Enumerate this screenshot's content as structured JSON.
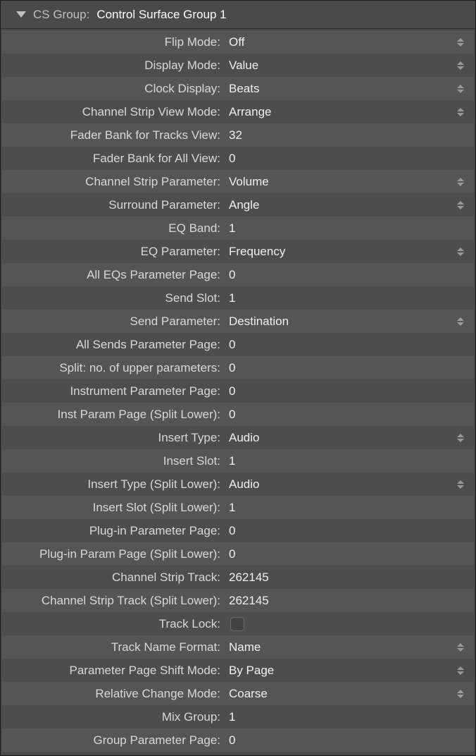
{
  "header": {
    "label": "CS Group:",
    "value": "Control Surface Group 1"
  },
  "rows": [
    {
      "label": "Flip Mode:",
      "value": "Off",
      "type": "select"
    },
    {
      "label": "Display Mode:",
      "value": "Value",
      "type": "select"
    },
    {
      "label": "Clock Display:",
      "value": "Beats",
      "type": "select"
    },
    {
      "label": "Channel Strip View Mode:",
      "value": "Arrange",
      "type": "select"
    },
    {
      "label": "Fader Bank for Tracks View:",
      "value": "32",
      "type": "number"
    },
    {
      "label": "Fader Bank for All View:",
      "value": "0",
      "type": "number"
    },
    {
      "label": "Channel Strip Parameter:",
      "value": "Volume",
      "type": "select"
    },
    {
      "label": "Surround Parameter:",
      "value": "Angle",
      "type": "select"
    },
    {
      "label": "EQ Band:",
      "value": "1",
      "type": "number"
    },
    {
      "label": "EQ Parameter:",
      "value": "Frequency",
      "type": "select"
    },
    {
      "label": "All EQs Parameter Page:",
      "value": "0",
      "type": "number"
    },
    {
      "label": "Send Slot:",
      "value": "1",
      "type": "number"
    },
    {
      "label": "Send Parameter:",
      "value": "Destination",
      "type": "select"
    },
    {
      "label": "All Sends Parameter Page:",
      "value": "0",
      "type": "number"
    },
    {
      "label": "Split: no. of upper parameters:",
      "value": "0",
      "type": "number"
    },
    {
      "label": "Instrument Parameter Page:",
      "value": "0",
      "type": "number"
    },
    {
      "label": "Inst Param Page (Split Lower):",
      "value": "0",
      "type": "number"
    },
    {
      "label": "Insert Type:",
      "value": "Audio",
      "type": "select"
    },
    {
      "label": "Insert Slot:",
      "value": "1",
      "type": "number"
    },
    {
      "label": "Insert Type (Split Lower):",
      "value": "Audio",
      "type": "select"
    },
    {
      "label": "Insert Slot (Split Lower):",
      "value": "1",
      "type": "number"
    },
    {
      "label": "Plug-in Parameter Page:",
      "value": "0",
      "type": "number"
    },
    {
      "label": "Plug-in Param Page (Split Lower):",
      "value": "0",
      "type": "number"
    },
    {
      "label": "Channel Strip Track:",
      "value": "262145",
      "type": "number"
    },
    {
      "label": "Channel Strip Track (Split Lower):",
      "value": "262145",
      "type": "number"
    },
    {
      "label": "Track Lock:",
      "value": "",
      "type": "checkbox"
    },
    {
      "label": "Track Name Format:",
      "value": "Name",
      "type": "select"
    },
    {
      "label": "Parameter Page Shift Mode:",
      "value": "By Page",
      "type": "select"
    },
    {
      "label": "Relative Change Mode:",
      "value": "Coarse",
      "type": "select"
    },
    {
      "label": "Mix Group:",
      "value": "1",
      "type": "number"
    },
    {
      "label": "Group Parameter Page:",
      "value": "0",
      "type": "number"
    }
  ]
}
